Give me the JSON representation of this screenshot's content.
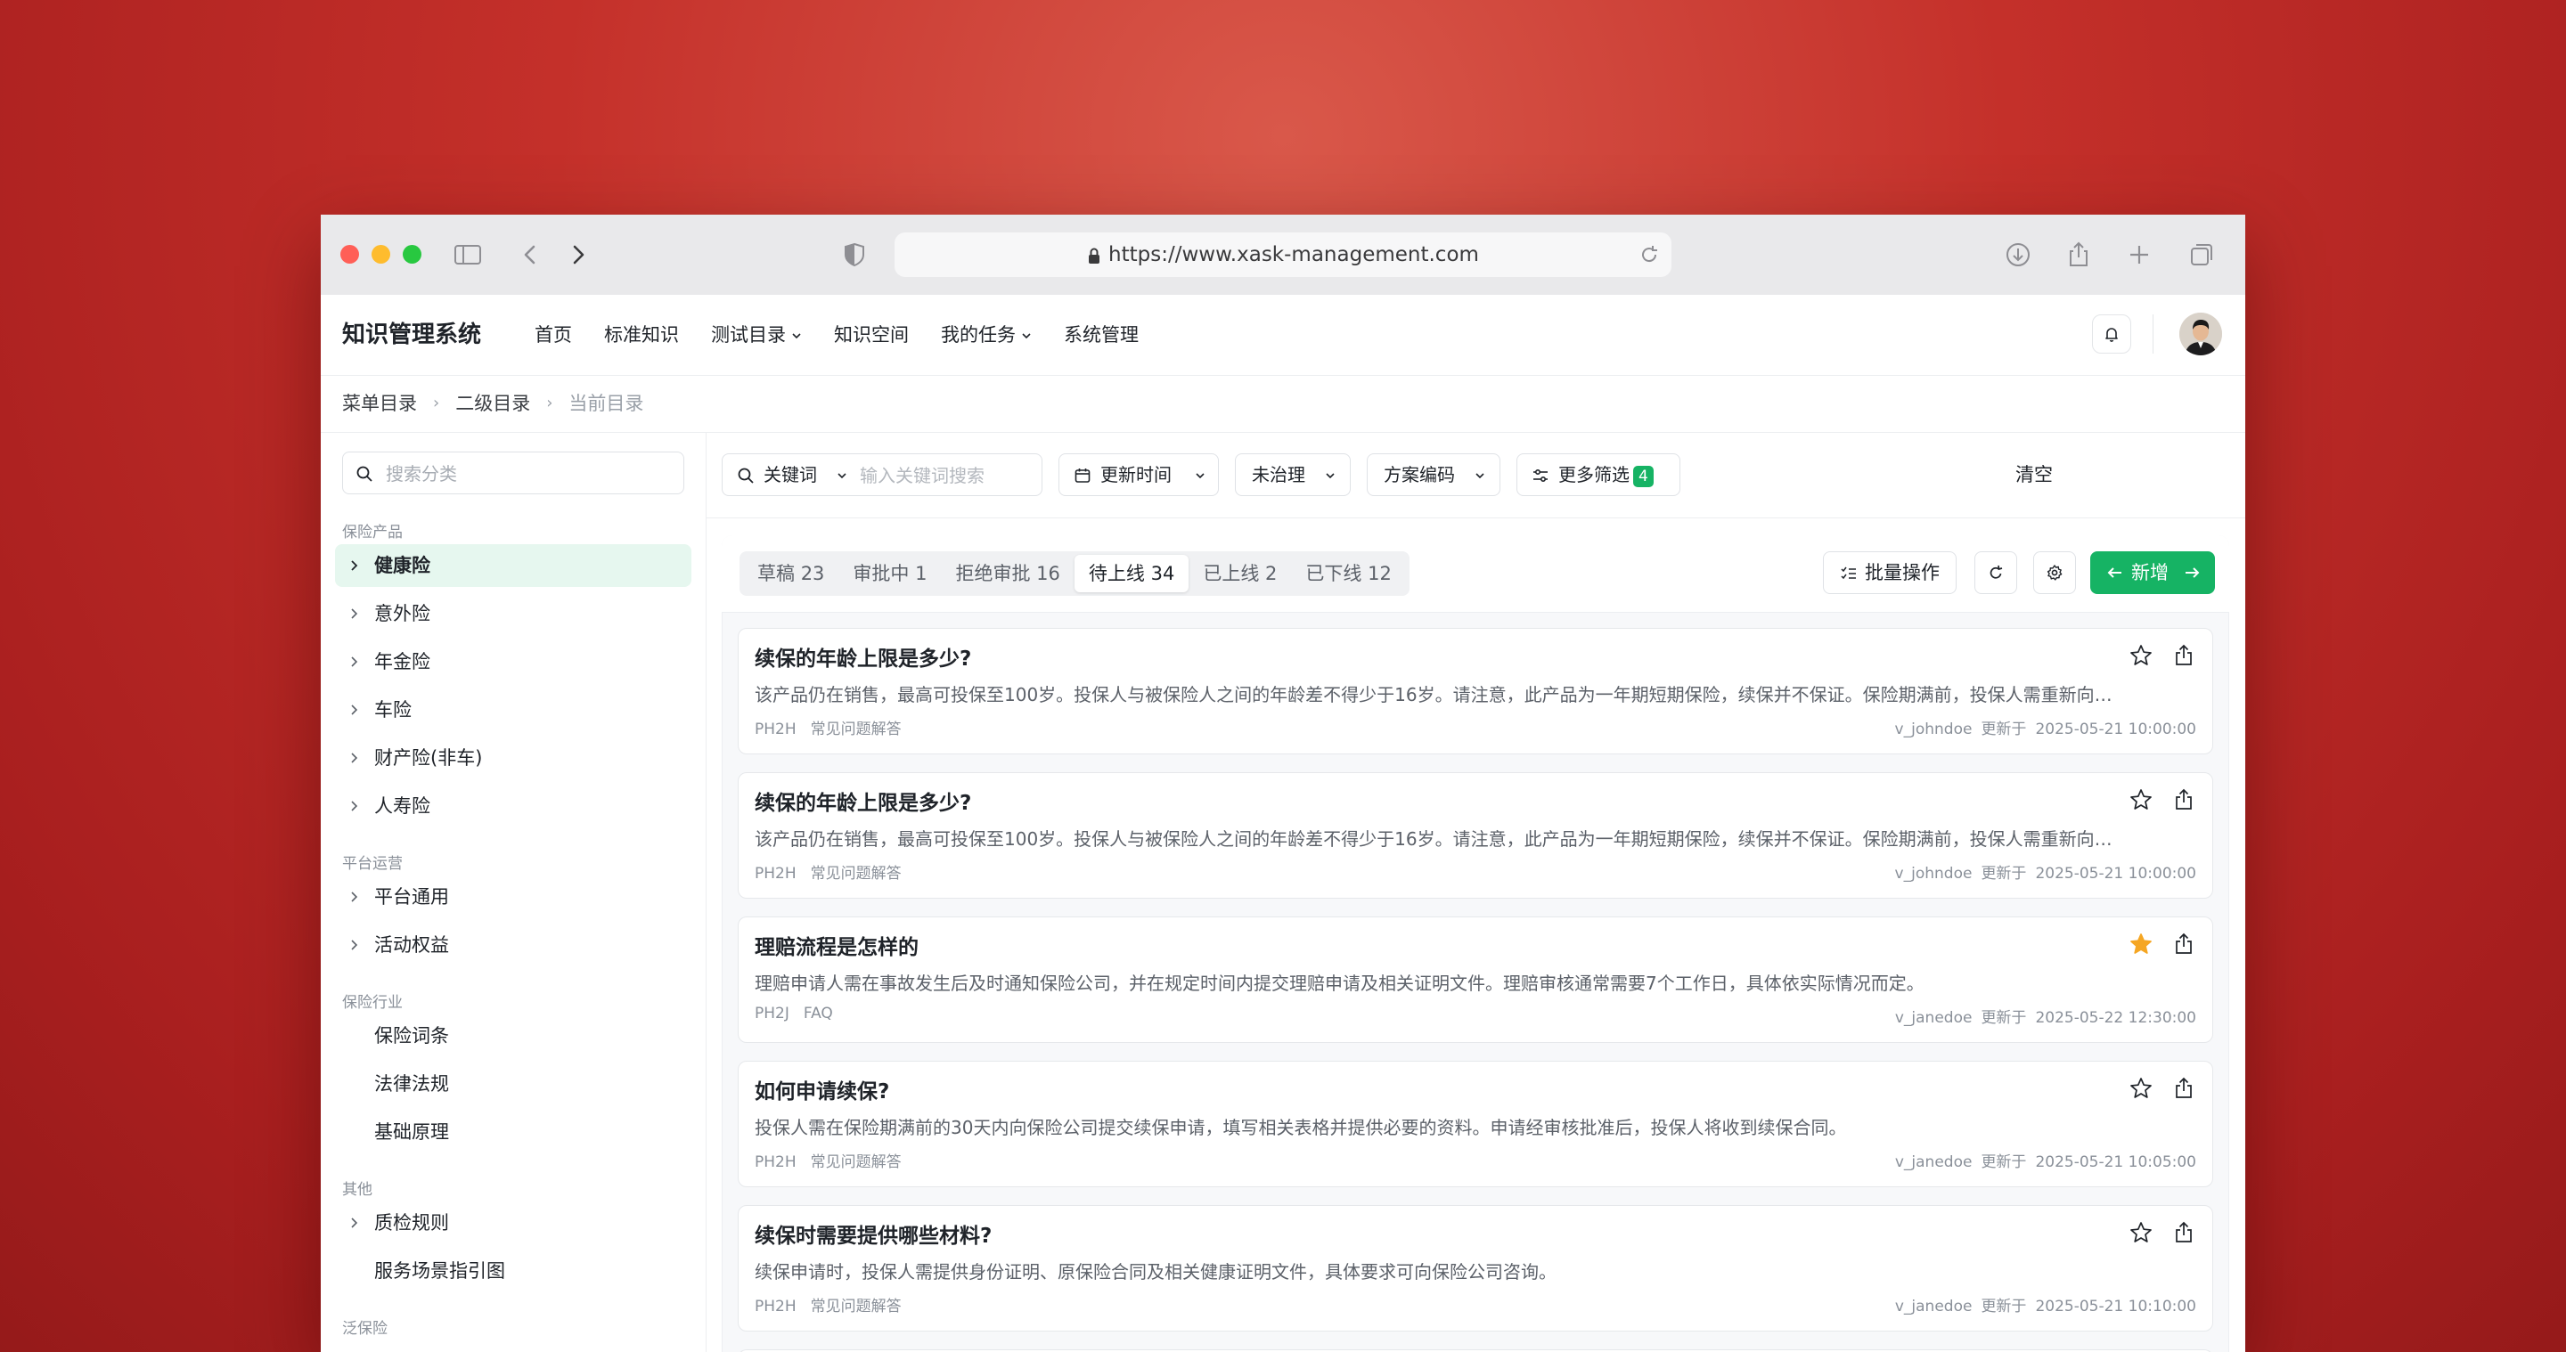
{
  "browser": {
    "url": "https://www.xask-management.com"
  },
  "app": {
    "title": "知识管理系统"
  },
  "nav": [
    {
      "label": "首页",
      "dropdown": false
    },
    {
      "label": "标准知识",
      "dropdown": false
    },
    {
      "label": "测试目录",
      "dropdown": true
    },
    {
      "label": "知识空间",
      "dropdown": false
    },
    {
      "label": "我的任务",
      "dropdown": true
    },
    {
      "label": "系统管理",
      "dropdown": false
    }
  ],
  "breadcrumb": [
    "菜单目录",
    "二级目录",
    "当前目录"
  ],
  "sidebar": {
    "search_placeholder": "搜索分类",
    "sections": [
      {
        "label": "保险产品",
        "items": [
          {
            "label": "健康险",
            "expandable": true,
            "active": true
          },
          {
            "label": "意外险",
            "expandable": true
          },
          {
            "label": "年金险",
            "expandable": true
          },
          {
            "label": "车险",
            "expandable": true
          },
          {
            "label": "财产险(非车)",
            "expandable": true
          },
          {
            "label": "人寿险",
            "expandable": true
          }
        ]
      },
      {
        "label": "平台运营",
        "items": [
          {
            "label": "平台通用",
            "expandable": true
          },
          {
            "label": "活动权益",
            "expandable": true
          }
        ]
      },
      {
        "label": "保险行业",
        "items": [
          {
            "label": "保险词条",
            "expandable": false
          },
          {
            "label": "法律法规",
            "expandable": false
          },
          {
            "label": "基础原理",
            "expandable": false
          }
        ]
      },
      {
        "label": "其他",
        "items": [
          {
            "label": "质检规则",
            "expandable": true
          },
          {
            "label": "服务场景指引图",
            "expandable": false
          }
        ]
      },
      {
        "label": "泛保险",
        "items": []
      }
    ]
  },
  "filters": {
    "keyword_label": "关键词",
    "keyword_placeholder": "输入关键词搜索",
    "update_time": "更新时间",
    "status": "未治理",
    "plan_code": "方案编码",
    "more": "更多筛选",
    "more_count": "4",
    "clear": "清空"
  },
  "tabs": [
    {
      "label": "草稿",
      "count": "23"
    },
    {
      "label": "审批中",
      "count": "1"
    },
    {
      "label": "拒绝审批",
      "count": "16"
    },
    {
      "label": "待上线",
      "count": "34",
      "active": true
    },
    {
      "label": "已上线",
      "count": "2"
    },
    {
      "label": "已下线",
      "count": "12"
    }
  ],
  "actions": {
    "batch": "批量操作",
    "new": "新增"
  },
  "colors": {
    "accent": "#16b364",
    "active_bg": "#e6f7ef",
    "star": "#f5a623"
  },
  "cards": [
    {
      "title": "续保的年龄上限是多少?",
      "desc": "该产品仍在销售，最高可投保至100岁。投保人与被保险人之间的年龄差不得少于16岁。请注意，此产品为一年期短期保险，续保并不保证。保险期满前，投保人需重新向保险公司申请投保。",
      "code": "PH2H",
      "tag": "常见问题解答",
      "user": "v_johndoe",
      "updated_label": "更新于",
      "time": "2025-05-21 10:00:00",
      "starred": false
    },
    {
      "title": "续保的年龄上限是多少?",
      "desc": "该产品仍在销售，最高可投保至100岁。投保人与被保险人之间的年龄差不得少于16岁。请注意，此产品为一年期短期保险，续保并不保证。保险期满前，投保人需重新向保险公司申请投保。",
      "code": "PH2H",
      "tag": "常见问题解答",
      "user": "v_johndoe",
      "updated_label": "更新于",
      "time": "2025-05-21 10:00:00",
      "starred": false
    },
    {
      "title": "理赔流程是怎样的",
      "desc": "理赔申请人需在事故发生后及时通知保险公司，并在规定时间内提交理赔申请及相关证明文件。理赔审核通常需要7个工作日，具体依实际情况而定。",
      "code": "PH2J",
      "tag": "FAQ",
      "user": "v_janedoe",
      "updated_label": "更新于",
      "time": "2025-05-22 12:30:00",
      "starred": true
    },
    {
      "title": "如何申请续保?",
      "desc": "投保人需在保险期满前的30天内向保险公司提交续保申请，填写相关表格并提供必要的资料。申请经审核批准后，投保人将收到续保合同。",
      "code": "PH2H",
      "tag": "常见问题解答",
      "user": "v_janedoe",
      "updated_label": "更新于",
      "time": "2025-05-21 10:05:00",
      "starred": false
    },
    {
      "title": "续保时需要提供哪些材料?",
      "desc": "续保申请时，投保人需提供身份证明、原保险合同及相关健康证明文件，具体要求可向保险公司咨询。",
      "code": "PH2H",
      "tag": "常见问题解答",
      "user": "v_janedoe",
      "updated_label": "更新于",
      "time": "2025-05-21 10:10:00",
      "starred": false
    }
  ]
}
